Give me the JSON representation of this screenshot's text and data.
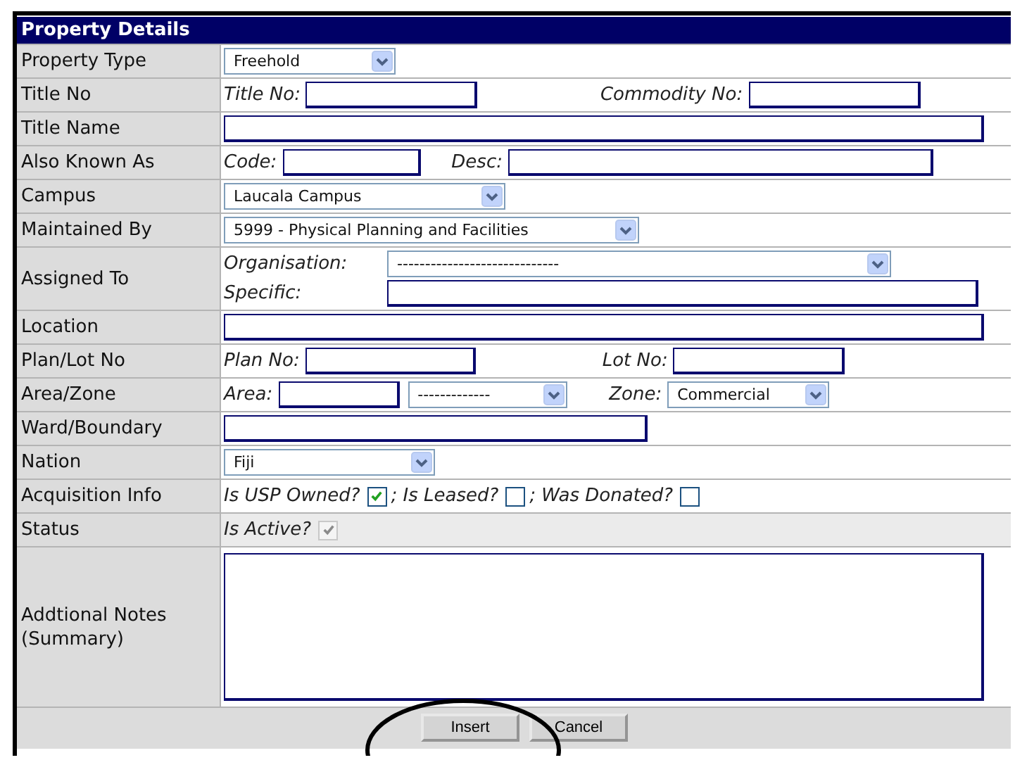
{
  "title": "Property Details",
  "rows": [
    {
      "label": "Property Type",
      "lines": [
        [
          {
            "kind": "select",
            "value": "Freehold"
          }
        ]
      ]
    },
    {
      "label": "Title No",
      "lines": [
        [
          {
            "kind": "caption",
            "text": "Title No:"
          },
          {
            "kind": "input"
          },
          {
            "kind": "caption",
            "text": "Commodity No:"
          },
          {
            "kind": "input"
          }
        ]
      ]
    },
    {
      "label": "Title Name",
      "lines": [
        [
          {
            "kind": "input"
          }
        ]
      ]
    },
    {
      "label": "Also Known As",
      "lines": [
        [
          {
            "kind": "caption",
            "text": "Code:"
          },
          {
            "kind": "input"
          },
          {
            "kind": "caption",
            "text": "Desc:"
          },
          {
            "kind": "input"
          }
        ]
      ]
    },
    {
      "label": "Campus",
      "lines": [
        [
          {
            "kind": "select",
            "value": "Laucala Campus"
          }
        ]
      ]
    },
    {
      "label": "Maintained By",
      "lines": [
        [
          {
            "kind": "select",
            "value": "5999 - Physical Planning and Facilities"
          }
        ]
      ]
    },
    {
      "label": "Assigned To",
      "lines": [
        [
          {
            "kind": "caption",
            "text": "Organisation:"
          },
          {
            "kind": "select",
            "value": "-----------------------------"
          }
        ],
        [
          {
            "kind": "caption",
            "text": "Specific:"
          },
          {
            "kind": "input"
          }
        ]
      ]
    },
    {
      "label": "Location",
      "lines": [
        [
          {
            "kind": "input"
          }
        ]
      ]
    },
    {
      "label": "Plan/Lot No",
      "lines": [
        [
          {
            "kind": "caption",
            "text": "Plan No:"
          },
          {
            "kind": "input"
          },
          {
            "kind": "caption",
            "text": "Lot No:"
          },
          {
            "kind": "input"
          }
        ]
      ]
    },
    {
      "label": "Area/Zone",
      "lines": [
        [
          {
            "kind": "caption",
            "text": "Area:"
          },
          {
            "kind": "input"
          },
          {
            "kind": "select",
            "value": "-------------"
          },
          {
            "kind": "caption",
            "text": "Zone:"
          },
          {
            "kind": "select",
            "value": "Commercial"
          }
        ]
      ]
    },
    {
      "label": "Ward/Boundary",
      "lines": [
        [
          {
            "kind": "input"
          }
        ]
      ]
    },
    {
      "label": "Nation",
      "lines": [
        [
          {
            "kind": "select",
            "value": "Fiji"
          }
        ]
      ]
    },
    {
      "label": "Acquisition Info",
      "lines": [
        [
          {
            "kind": "caption",
            "text": "Is USP Owned?"
          },
          {
            "kind": "checkbox",
            "checked": true,
            "disabled": false
          },
          {
            "kind": "caption",
            "text": "; Is Leased?"
          },
          {
            "kind": "checkbox",
            "checked": false,
            "disabled": false
          },
          {
            "kind": "caption",
            "text": "; Was Donated?"
          },
          {
            "kind": "checkbox",
            "checked": false,
            "disabled": false
          }
        ]
      ]
    },
    {
      "label": "Status",
      "lines": [
        [
          {
            "kind": "caption",
            "text": "Is Active?"
          },
          {
            "kind": "checkbox",
            "checked": true,
            "disabled": true
          }
        ]
      ]
    },
    {
      "label": "Addtional Notes (Summary)",
      "lines": [
        [
          {
            "kind": "textarea"
          }
        ]
      ]
    }
  ],
  "buttons": [
    "Insert",
    "Cancel"
  ]
}
